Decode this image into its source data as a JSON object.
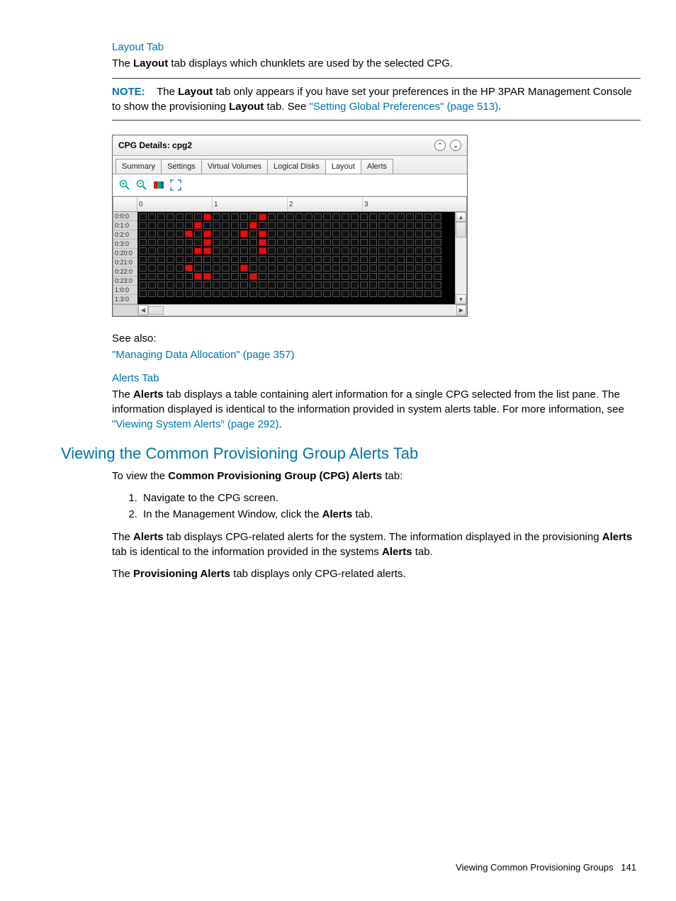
{
  "section_layout": {
    "heading": "Layout Tab",
    "para1_pre": "The ",
    "para1_bold": "Layout",
    "para1_post": " tab displays which chunklets are used by the selected CPG.",
    "note_label": "NOTE:",
    "note_body_1": " The ",
    "note_bold1": "Layout",
    "note_body_2": " tab only appears if you have set your preferences in the HP 3PAR Management Console to show the provisioning ",
    "note_bold2": "Layout",
    "note_body_3": " tab. See ",
    "note_link": "\"Setting Global Preferences\" (page 513)",
    "note_body_4": "."
  },
  "panel": {
    "title": "CPG Details: cpg2",
    "tabs": [
      "Summary",
      "Settings",
      "Virtual Volumes",
      "Logical Disks",
      "Layout",
      "Alerts"
    ],
    "active_tab_index": 4,
    "header_cols": [
      "0",
      "1",
      "2",
      "3"
    ],
    "row_labels": [
      "0:0:0",
      "0:1:0",
      "0:2:0",
      "0:3:0",
      "0:20:0",
      "0:21:0",
      "0:22:0",
      "0:23:0",
      "1:0:0",
      "1:3:0"
    ],
    "icons": {
      "collapse": "collapse-icon",
      "expand": "expand-icon",
      "zoom_in": "zoom-in-icon",
      "zoom_out": "zoom-out-icon",
      "legend": "color-legend-icon",
      "fullscreen": "expand-corners-icon"
    },
    "grid": {
      "cols": 33,
      "on_cells": {
        "0": [
          7,
          13
        ],
        "1": [
          6,
          12
        ],
        "2": [
          5,
          7,
          11,
          13
        ],
        "3": [
          7,
          13
        ],
        "4": [
          6,
          7,
          13
        ],
        "5": [],
        "6": [
          5,
          11
        ],
        "7": [
          6,
          7,
          12
        ],
        "8": [],
        "9": []
      }
    }
  },
  "see_also": {
    "label": "See also:",
    "link": "\"Managing Data Allocation\" (page 357)"
  },
  "section_alerts": {
    "heading": "Alerts Tab",
    "para_pre": "The ",
    "para_bold": "Alerts",
    "para_post": " tab displays a table containing alert information for a single CPG selected from the list pane. The information displayed is identical to the information provided in system alerts table. For more information, see ",
    "para_link": "\"Viewing System Alerts\" (page 292)",
    "para_end": "."
  },
  "section_viewing": {
    "heading": "Viewing the Common Provisioning Group Alerts Tab",
    "intro_pre": "To view the ",
    "intro_bold": "Common Provisioning Group (CPG) Alerts",
    "intro_post": " tab:",
    "steps": [
      {
        "text": "Navigate to the CPG screen."
      },
      {
        "pre": "In the Management Window, click the ",
        "bold": "Alerts",
        "post": " tab."
      }
    ],
    "p2_pre": "The ",
    "p2_b1": "Alerts",
    "p2_mid1": " tab displays CPG-related alerts for the system. The information displayed in the provisioning ",
    "p2_b2": "Alerts",
    "p2_mid2": " tab is identical to the information provided in the systems ",
    "p2_b3": "Alerts",
    "p2_post": " tab.",
    "p3_pre": "The ",
    "p3_bold": "Provisioning Alerts",
    "p3_post": " tab displays only CPG-related alerts."
  },
  "footer": {
    "text": "Viewing Common Provisioning Groups",
    "page": "141"
  }
}
